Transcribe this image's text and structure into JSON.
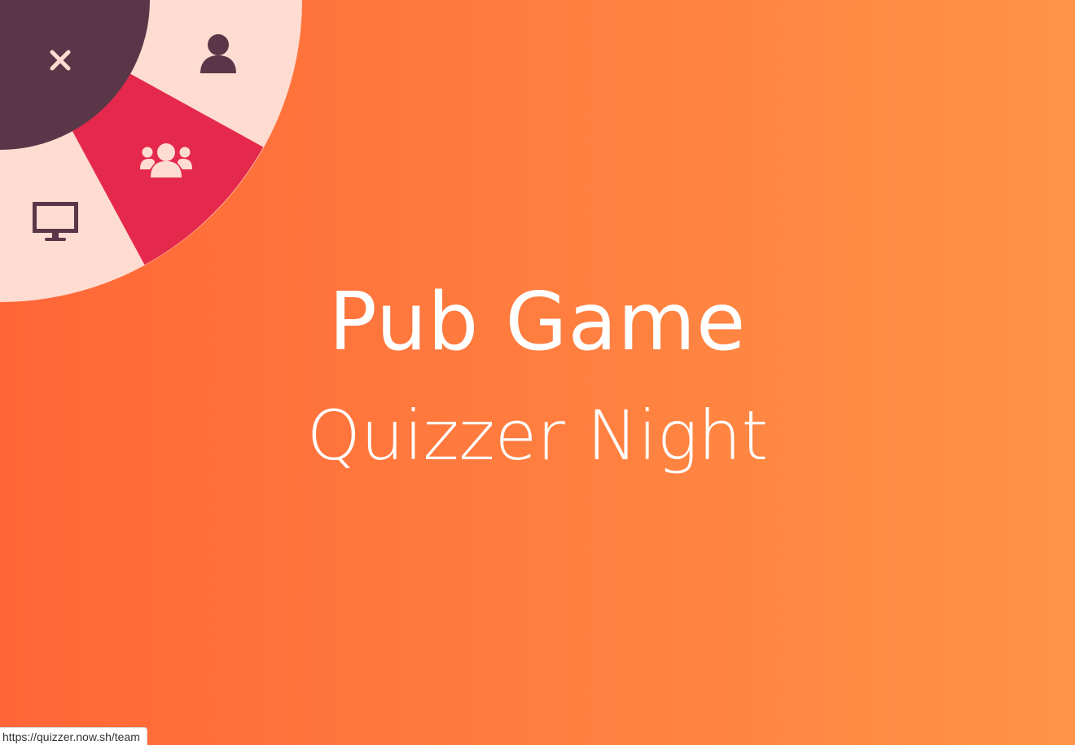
{
  "hero": {
    "title": "Pub Game",
    "subtitle": "Quizzer Night"
  },
  "menu": {
    "items": [
      {
        "id": "close",
        "icon": "close-icon",
        "label": "",
        "interactable": true
      },
      {
        "id": "player",
        "icon": "user-icon",
        "label": "",
        "interactable": true
      },
      {
        "id": "team",
        "icon": "users-icon",
        "label": "",
        "interactable": true,
        "active": true
      },
      {
        "id": "host",
        "icon": "desktop-icon",
        "label": "",
        "interactable": true
      }
    ]
  },
  "status_bar": {
    "url": "https://quizzer.now.sh/team"
  },
  "colors": {
    "background_start": "#ff6637",
    "background_end": "#ff9446",
    "menu_light": "#ffdcd1",
    "menu_active": "#e5294c",
    "menu_dark": "#5a3748",
    "text": "#ffffff"
  }
}
